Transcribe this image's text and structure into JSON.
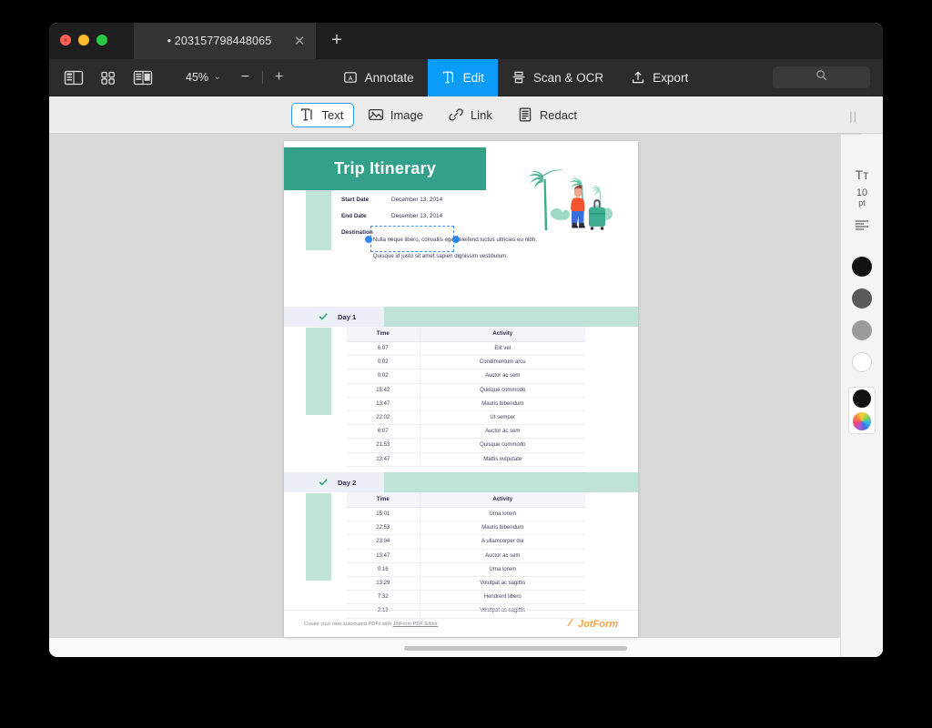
{
  "window": {
    "traffic_lights": [
      "close",
      "minimize",
      "maximize"
    ]
  },
  "tab": {
    "title": "• 203157798448065",
    "close_label": "✕",
    "new_tab_label": "+"
  },
  "toolbar": {
    "view_icons": [
      "sidebar-icon",
      "thumbnail-grid-icon",
      "page-layout-icon"
    ],
    "zoom_level": "45%",
    "zoom_caret": "⌄",
    "zoom_out": "−",
    "zoom_in": "+",
    "modes": [
      {
        "label": "Annotate",
        "icon": "annotate-icon",
        "active": false
      },
      {
        "label": "Edit",
        "icon": "edit-text-icon",
        "active": true
      },
      {
        "label": "Scan & OCR",
        "icon": "scan-ocr-icon",
        "active": false
      },
      {
        "label": "Export",
        "icon": "export-icon",
        "active": false
      }
    ],
    "search_placeholder": "",
    "accent_color": "#0b9cf9"
  },
  "subtoolbar": {
    "tools": [
      {
        "label": "Text",
        "icon": "text-tool-icon",
        "active": true
      },
      {
        "label": "Image",
        "icon": "image-tool-icon",
        "active": false
      },
      {
        "label": "Link",
        "icon": "link-tool-icon",
        "active": false
      },
      {
        "label": "Redact",
        "icon": "redact-tool-icon",
        "active": false
      }
    ],
    "grip": "||"
  },
  "document": {
    "title": "Trip Itinerary",
    "header_color": "#33a189",
    "accent_color": "#bfe3d6",
    "meta": [
      {
        "label": "Start Date",
        "value": "December 13, 2014"
      },
      {
        "label": "End Date",
        "value": "December 13, 2014"
      },
      {
        "label": "Destination",
        "value": "Nulla neque libero, convallis eget, eleifend luctus ultricies eu nibh. Quisque id justo sit amet sapien dignissim vestibulum."
      }
    ],
    "selection_active": true,
    "days": [
      {
        "label": "Day 1",
        "checked": true,
        "columns": [
          "Time",
          "Activity"
        ],
        "rows": [
          [
            "6:07",
            "Elit vel"
          ],
          [
            "0:02",
            "Condimentum arcu"
          ],
          [
            "0:02",
            "Auctor ac sem"
          ],
          [
            "15:42",
            "Quisque commodo"
          ],
          [
            "13:47",
            "Mauris bibendum"
          ],
          [
            "22:02",
            "Ut semper"
          ],
          [
            "6:07",
            "Auctor ac sem"
          ],
          [
            "21:53",
            "Quisque commodo"
          ],
          [
            "13:47",
            "Mattis vulputate"
          ]
        ]
      },
      {
        "label": "Day 2",
        "checked": true,
        "columns": [
          "Time",
          "Activity"
        ],
        "rows": [
          [
            "15:01",
            "Urna lorem"
          ],
          [
            "22:53",
            "Mauris bibendum"
          ],
          [
            "23:04",
            "A ullamcorper dui"
          ],
          [
            "13:47",
            "Auctor ac sem"
          ],
          [
            "0:16",
            "Urna lorem"
          ],
          [
            "13:29",
            "Volutpat ac sagittis"
          ],
          [
            "7:32",
            "Hendrerit libero"
          ],
          [
            "2:13",
            "Volutpat ac sagittis"
          ]
        ]
      }
    ],
    "footer": {
      "text_before": "Create your own automated PDFs with ",
      "link": "JotForm PDF Editor",
      "brand": "JotForm",
      "brand_color": "#f9a24a"
    }
  },
  "properties_panel": {
    "font_icon": "Tт",
    "font_size": "10",
    "font_size_unit": "pt",
    "align_icon": "align-left-icon",
    "swatches": [
      "#121212",
      "#5a5a5a",
      "#9b9b9b",
      "#ffffff"
    ],
    "current_color": "#121212",
    "color_wheel_label": "color-wheel"
  }
}
